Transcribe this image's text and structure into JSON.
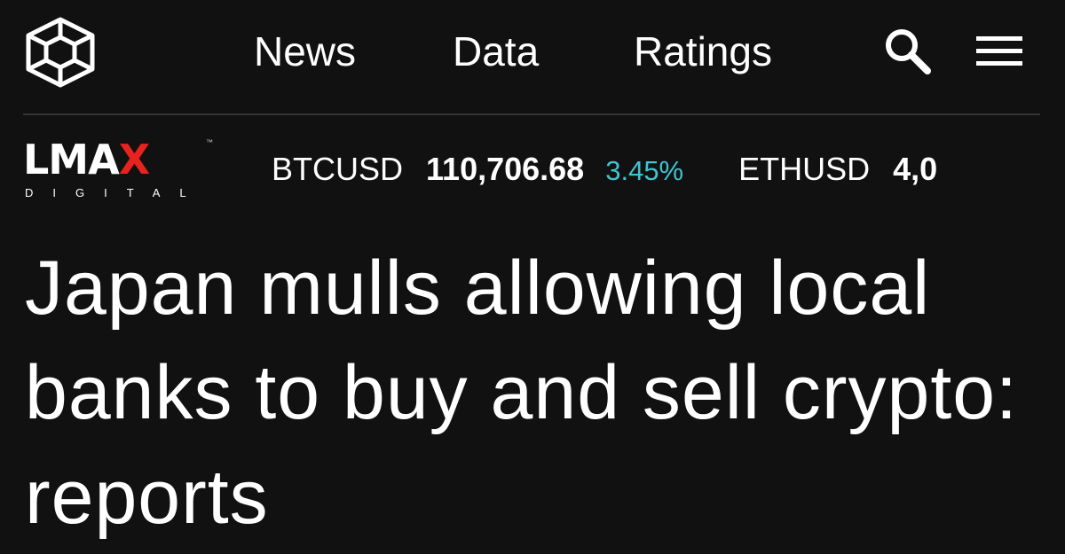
{
  "header": {
    "logo_icon": "block-cube-logo-icon",
    "nav": [
      {
        "label": "News"
      },
      {
        "label": "Data"
      },
      {
        "label": "Ratings"
      }
    ],
    "search_icon": "search-icon",
    "menu_icon": "hamburger-menu-icon"
  },
  "sponsor": {
    "name": "LMAX",
    "name_main": "LMA",
    "name_accent": "X",
    "trademark": "™",
    "subtitle": "DIGITAL",
    "accent_color": "#e8231f"
  },
  "ticker": [
    {
      "symbol": "BTCUSD",
      "price": "110,706.68",
      "change": "3.45%",
      "change_color": "#3fc4d0"
    },
    {
      "symbol": "ETHUSD",
      "price": "4,0"
    }
  ],
  "article": {
    "headline": "Japan mulls allowing local banks to buy and sell crypto: reports"
  },
  "colors": {
    "background": "#111111",
    "text": "#ffffff",
    "divider": "#333333"
  }
}
